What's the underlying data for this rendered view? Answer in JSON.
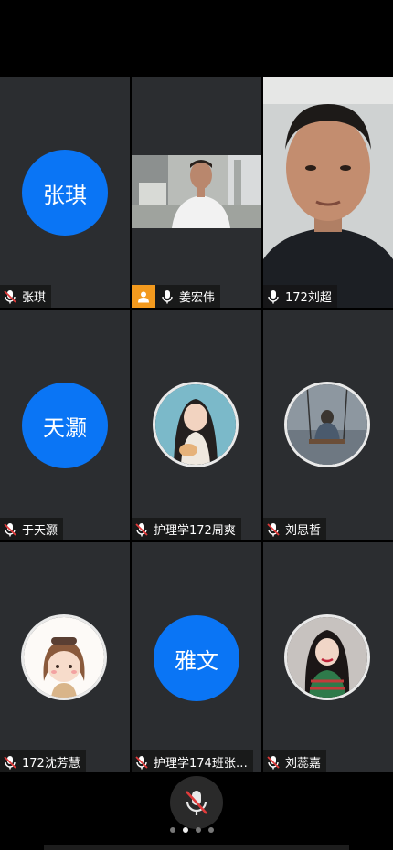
{
  "participants": [
    {
      "name": "张琪",
      "avatar_text": "张琪",
      "mic": "muted",
      "avatar_color": "#0a75f5"
    },
    {
      "name": "姜宏伟",
      "mic": "active",
      "host": true
    },
    {
      "name": "172刘超",
      "mic": "active"
    },
    {
      "name": "于天灏",
      "avatar_text": "天灏",
      "mic": "muted",
      "avatar_color": "#0a75f5"
    },
    {
      "name": "护理学172周爽",
      "mic": "muted"
    },
    {
      "name": "刘思哲",
      "mic": "muted"
    },
    {
      "name": "172沈芳慧",
      "mic": "muted"
    },
    {
      "name": "护理学174班张…",
      "avatar_text": "雅文",
      "mic": "muted",
      "avatar_color": "#0a75f5"
    },
    {
      "name": "刘蕊嘉",
      "mic": "muted"
    }
  ],
  "controls": {
    "mic_button_icon": "mic-muted-icon",
    "page_indicator": {
      "total": 4,
      "current": 2
    }
  },
  "colors": {
    "tile_bg": "#2b2d30",
    "avatar_blue": "#0a75f5",
    "mute_red": "#e03b3b",
    "host_badge": "#f39a1e"
  }
}
